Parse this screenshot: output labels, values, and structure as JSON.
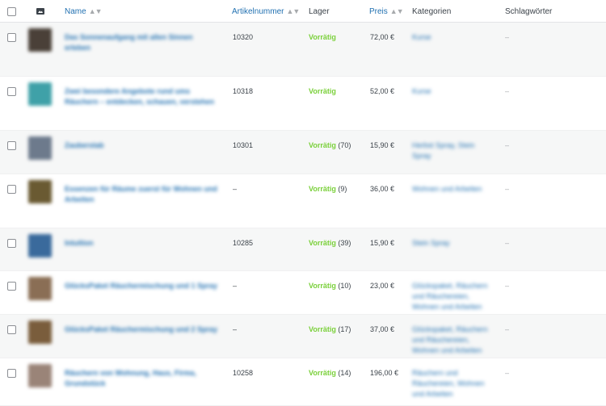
{
  "header": {
    "name_label": "Name",
    "sku_label": "Artikelnummer",
    "stock_label": "Lager",
    "price_label": "Preis",
    "categories_label": "Kategorien",
    "tags_label": "Schlagwörter",
    "sort_indicator": "▲▼"
  },
  "colors": {
    "link": "#2271b1",
    "in_stock": "#7ad03a",
    "text": "#3c434a",
    "row_alt": "#f6f7f7"
  },
  "rows": [
    {
      "name": "Das Sonnenaufgang mit allen Sinnen erleben",
      "sku": "10320",
      "stock": "Vorrätig",
      "qty": "",
      "price": "72,00 €",
      "categories": "Kurse",
      "tags": "–",
      "thumb": "#4a4038"
    },
    {
      "name": "Zwei besondere Angebote rund ums Räuchern – entdecken, schauen, verstehen",
      "sku": "10318",
      "stock": "Vorrätig",
      "qty": "",
      "price": "52,00 €",
      "categories": "Kurse",
      "tags": "–",
      "thumb": "#3fa1a8"
    },
    {
      "name": "Zauberstab",
      "sku": "10301",
      "stock": "Vorrätig",
      "qty": "(70)",
      "price": "15,90 €",
      "categories": "Herbst Spray, Stein Spray",
      "tags": "–",
      "thumb": "#6d7a8c"
    },
    {
      "name": "Essenzen für Räume zuerst für Wohnen und Arbeiten",
      "sku": "–",
      "stock": "Vorrätig",
      "qty": "(9)",
      "price": "36,00 €",
      "categories": "Wohnen und Arbeiten",
      "tags": "–",
      "thumb": "#6a5a32"
    },
    {
      "name": "Intuition",
      "sku": "10285",
      "stock": "Vorrätig",
      "qty": "(39)",
      "price": "15,90 €",
      "categories": "Stein Spray",
      "tags": "–",
      "thumb": "#3a6a9c"
    },
    {
      "name": "GlücksPaket Räuchermischung und 1 Spray",
      "sku": "–",
      "stock": "Vorrätig",
      "qty": "(10)",
      "price": "23,00 €",
      "categories": "Glückspaket, Räuchern und Räuchereien, Wohnen und Arbeiten",
      "tags": "–",
      "thumb": "#8a6e55"
    },
    {
      "name": "GlücksPaket Räuchermischung und 2 Spray",
      "sku": "–",
      "stock": "Vorrätig",
      "qty": "(17)",
      "price": "37,00 €",
      "categories": "Glückspaket, Räuchern und Räuchereien, Wohnen und Arbeiten",
      "tags": "–",
      "thumb": "#7a5d3c"
    },
    {
      "name": "Räuchern von Wohnung, Haus, Firma, Grundstück",
      "sku": "10258",
      "stock": "Vorrätig",
      "qty": "(14)",
      "price": "196,00 €",
      "categories": "Räuchern und Räuchereien, Wohnen und Arbeiten",
      "tags": "–",
      "thumb": "#9a8478"
    }
  ]
}
